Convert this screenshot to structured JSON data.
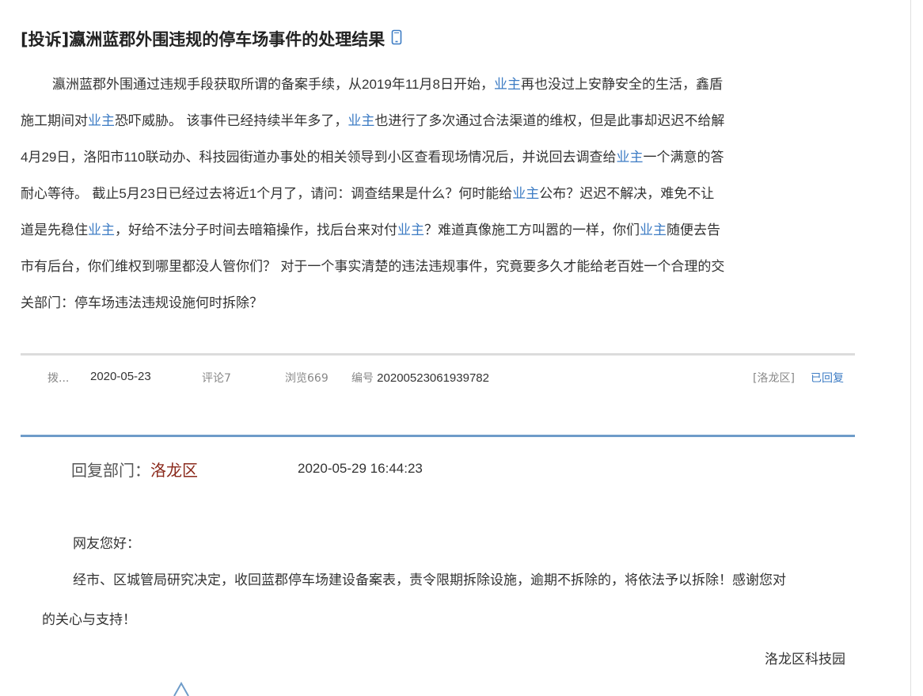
{
  "complaint": {
    "title": "[投诉]瀛洲蓝郡外围违规的停车场事件的处理结果",
    "body_lines": [
      [
        {
          "t": "瀛洲蓝郡外围通过违规手段获取所谓的备案手续，从"
        },
        {
          "t": "2019",
          "num": true
        },
        {
          "t": "年"
        },
        {
          "t": "11",
          "num": true
        },
        {
          "t": "月"
        },
        {
          "t": "8",
          "num": true
        },
        {
          "t": "日开始，"
        },
        {
          "t": "业主",
          "link": true
        },
        {
          "t": "再也没过上安静安全的生活，鑫盾"
        }
      ],
      [
        {
          "t": "施工期间对"
        },
        {
          "t": "业主",
          "link": true
        },
        {
          "t": "恐吓威胁。 该事件已经持续半年多了，"
        },
        {
          "t": "业主",
          "link": true
        },
        {
          "t": "也进行了多次通过合法渠道的维权，但是此事却迟迟不给解"
        }
      ],
      [
        {
          "t": "4",
          "num": true
        },
        {
          "t": "月"
        },
        {
          "t": "29",
          "num": true
        },
        {
          "t": "日，洛阳市"
        },
        {
          "t": "110",
          "num": true
        },
        {
          "t": "联动办、科技园街道办事处的相关领导到小区查看现场情况后，并说回去调查给"
        },
        {
          "t": "业主",
          "link": true
        },
        {
          "t": "一个满意的答"
        }
      ],
      [
        {
          "t": "耐心等待。 截止"
        },
        {
          "t": "5",
          "num": true
        },
        {
          "t": "月"
        },
        {
          "t": "23",
          "num": true
        },
        {
          "t": "日已经过去将近"
        },
        {
          "t": "1",
          "num": true
        },
        {
          "t": "个月了，请问：调查结果是什么？何时能给"
        },
        {
          "t": "业主",
          "link": true
        },
        {
          "t": "公布？迟迟不解决，难免不让"
        }
      ],
      [
        {
          "t": "道是先稳住"
        },
        {
          "t": "业主",
          "link": true
        },
        {
          "t": "，好给不法分子时间去暗箱操作，找后台来对付"
        },
        {
          "t": "业主",
          "link": true
        },
        {
          "t": "？难道真像施工方叫嚣的一样，你们"
        },
        {
          "t": "业主",
          "link": true
        },
        {
          "t": "随便去告"
        }
      ],
      [
        {
          "t": "市有后台，你们维权到哪里都没人管你们？ 对于一个事实清楚的违法违规事件，究竟要多久才能给老百姓一个合理的交"
        }
      ],
      [
        {
          "t": "关部门：停车场违法违规设施何时拆除？"
        }
      ]
    ]
  },
  "meta": {
    "author": "拨...",
    "date": "2020-05-23",
    "comments": "评论7",
    "views": "浏览669",
    "serial_label": "编号",
    "serial": "20200523061939782",
    "district": "[洛龙区]",
    "status": "已回复"
  },
  "reply": {
    "dept_label": "回复部门：",
    "dept_name": "洛龙区",
    "time": "2020-05-29 16:44:23",
    "greeting": "网友您好：",
    "line1": "经市、区城管局研究决定，收回蓝郡停车场建设备案表，责令限期拆除设施，逾期不拆除的，将依法予以拆除！感谢您对",
    "line2": "的关心与支持！",
    "signature": "洛龙区科技园"
  },
  "icons": {
    "title_icon": "mobile-phone-icon",
    "scroll_icon": "chevron-up-icon"
  },
  "colors": {
    "link": "#3d7cc4",
    "dept_name": "#8b2a1c",
    "divider_blue": "#6e9cc9",
    "divider_gray": "#dcdcdc"
  }
}
